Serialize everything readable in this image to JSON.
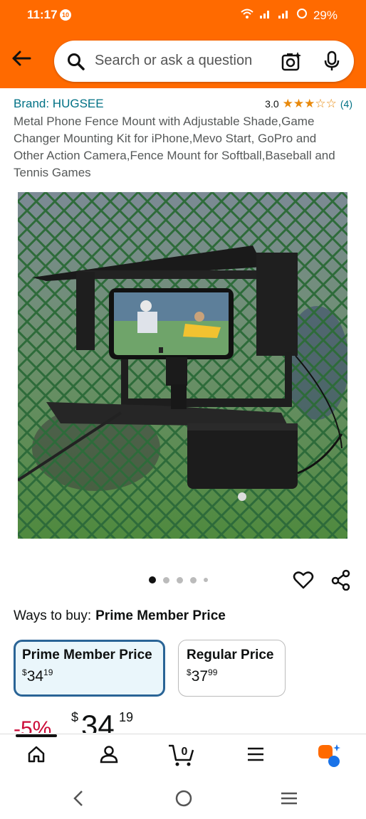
{
  "status": {
    "time": "11:17",
    "notif": "10",
    "battery": "29%"
  },
  "search": {
    "placeholder": "Search or ask a question"
  },
  "product": {
    "brand": "Brand: HUGSEE",
    "rating": "3.0",
    "stars": 3,
    "review_count": "(4)",
    "title": "Metal Phone Fence Mount with Adjustable Shade,Game Changer Mounting Kit for iPhone,Mevo Start, GoPro and Other Action Camera,Fence Mount for Softball,Baseball and Tennis Games"
  },
  "carousel": {
    "total": 5,
    "active": 1
  },
  "buy": {
    "ways_label": "Ways to buy:",
    "ways_selected": "Prime Member Price",
    "options": [
      {
        "name": "Prime Member Price",
        "currency": "$",
        "whole": "34",
        "fraction": "19"
      },
      {
        "name": "Regular Price",
        "currency": "$",
        "whole": "37",
        "fraction": "99"
      }
    ]
  },
  "price": {
    "discount": "-5%",
    "currency": "$",
    "whole": "34",
    "fraction": "19"
  },
  "cart": {
    "count": "0"
  },
  "colors": {
    "brand_orange": "#ff6a00",
    "link": "#007185",
    "deal_red": "#cc0c39",
    "selected_border": "#2a6496"
  },
  "icons": [
    "back-arrow-icon",
    "search-icon",
    "lens-icon",
    "mic-icon",
    "heart-icon",
    "share-icon",
    "home-icon",
    "account-icon",
    "cart-icon",
    "menu-icon",
    "rufus-icon"
  ]
}
